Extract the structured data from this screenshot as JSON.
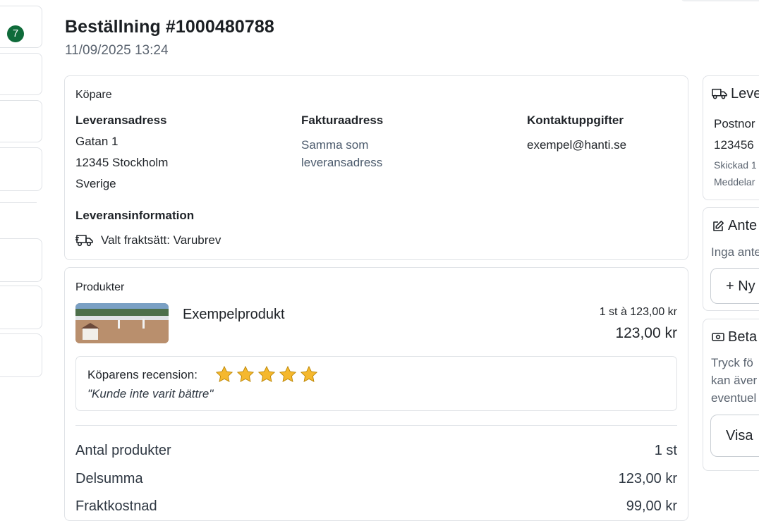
{
  "nav": {
    "badge_count": "7"
  },
  "header": {
    "title": "Beställning #1000480788",
    "datetime": "11/09/2025 13:24"
  },
  "buyer": {
    "section_title": "Köpare",
    "shipping": {
      "heading": "Leveransadress",
      "lines": [
        "Gatan 1",
        "12345 Stockholm",
        "Sverige"
      ]
    },
    "billing": {
      "heading": "Fakturaadress",
      "lines": [
        "Samma som",
        "leveransadress"
      ]
    },
    "contact": {
      "heading": "Kontaktuppgifter",
      "email": "exempel@hanti.se"
    },
    "delivery_info": {
      "heading": "Leveransinformation",
      "method": "Valt fraktsätt: Varubrev"
    }
  },
  "products": {
    "section_title": "Produkter",
    "items": [
      {
        "name": "Exempelprodukt",
        "unit_line": "1 st à 123,00 kr",
        "price": "123,00 kr"
      }
    ],
    "review": {
      "label": "Köparens recension:",
      "rating": 5,
      "text": "\"Kunde inte varit bättre\""
    }
  },
  "summary": {
    "rows": [
      {
        "label": "Antal produkter",
        "value": "1 st"
      },
      {
        "label": "Delsumma",
        "value": "123,00 kr"
      },
      {
        "label": "Fraktkostnad",
        "value": "99,00 kr"
      }
    ]
  },
  "sidebar": {
    "delivery": {
      "title": "Leve",
      "label": "Postnor",
      "tracking": "123456",
      "sent": "Skickad 1",
      "message": "Meddelar"
    },
    "notes": {
      "title": "Ante",
      "empty": "Inga ante",
      "button": "+ Ny"
    },
    "payment": {
      "title": "Beta",
      "lines": [
        "Tryck fö",
        "kan äver",
        "eventuel"
      ],
      "button": "Visa"
    }
  },
  "colors": {
    "accent_green": "#0f6b3a",
    "star": "#f5b82e",
    "border": "#dfe2e6"
  }
}
